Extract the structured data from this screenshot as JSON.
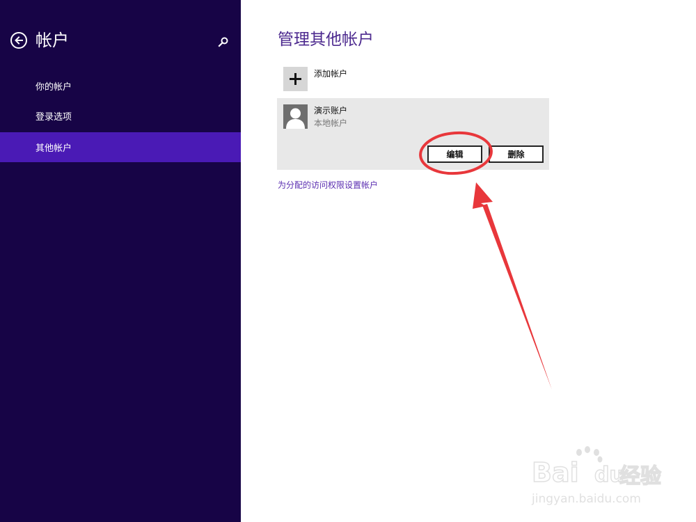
{
  "sidebar": {
    "title": "帐户",
    "items": [
      {
        "label": "你的帐户",
        "selected": false
      },
      {
        "label": "登录选项",
        "selected": false
      },
      {
        "label": "其他帐户",
        "selected": true
      }
    ],
    "background": "#170446",
    "selected_color": "#4a1ab5"
  },
  "main": {
    "title": "管理其他帐户",
    "add_account_label": "添加帐户",
    "account": {
      "name": "演示账户",
      "type": "本地帐户",
      "edit_label": "编辑",
      "delete_label": "删除"
    },
    "assigned_access_link": "为分配的访问权限设置帐户",
    "title_color": "#4d2a8f",
    "link_color": "#5a2db0"
  },
  "icons": {
    "back": "back-arrow-icon",
    "search": "search-icon",
    "add": "plus-icon",
    "avatar": "user-silhouette-icon"
  },
  "annotation": {
    "type": "red circle and arrow highlighting edit button",
    "color": "#e8373b"
  },
  "watermark": {
    "text": "Bai du 经验",
    "url": "jingyan.baidu.com"
  }
}
